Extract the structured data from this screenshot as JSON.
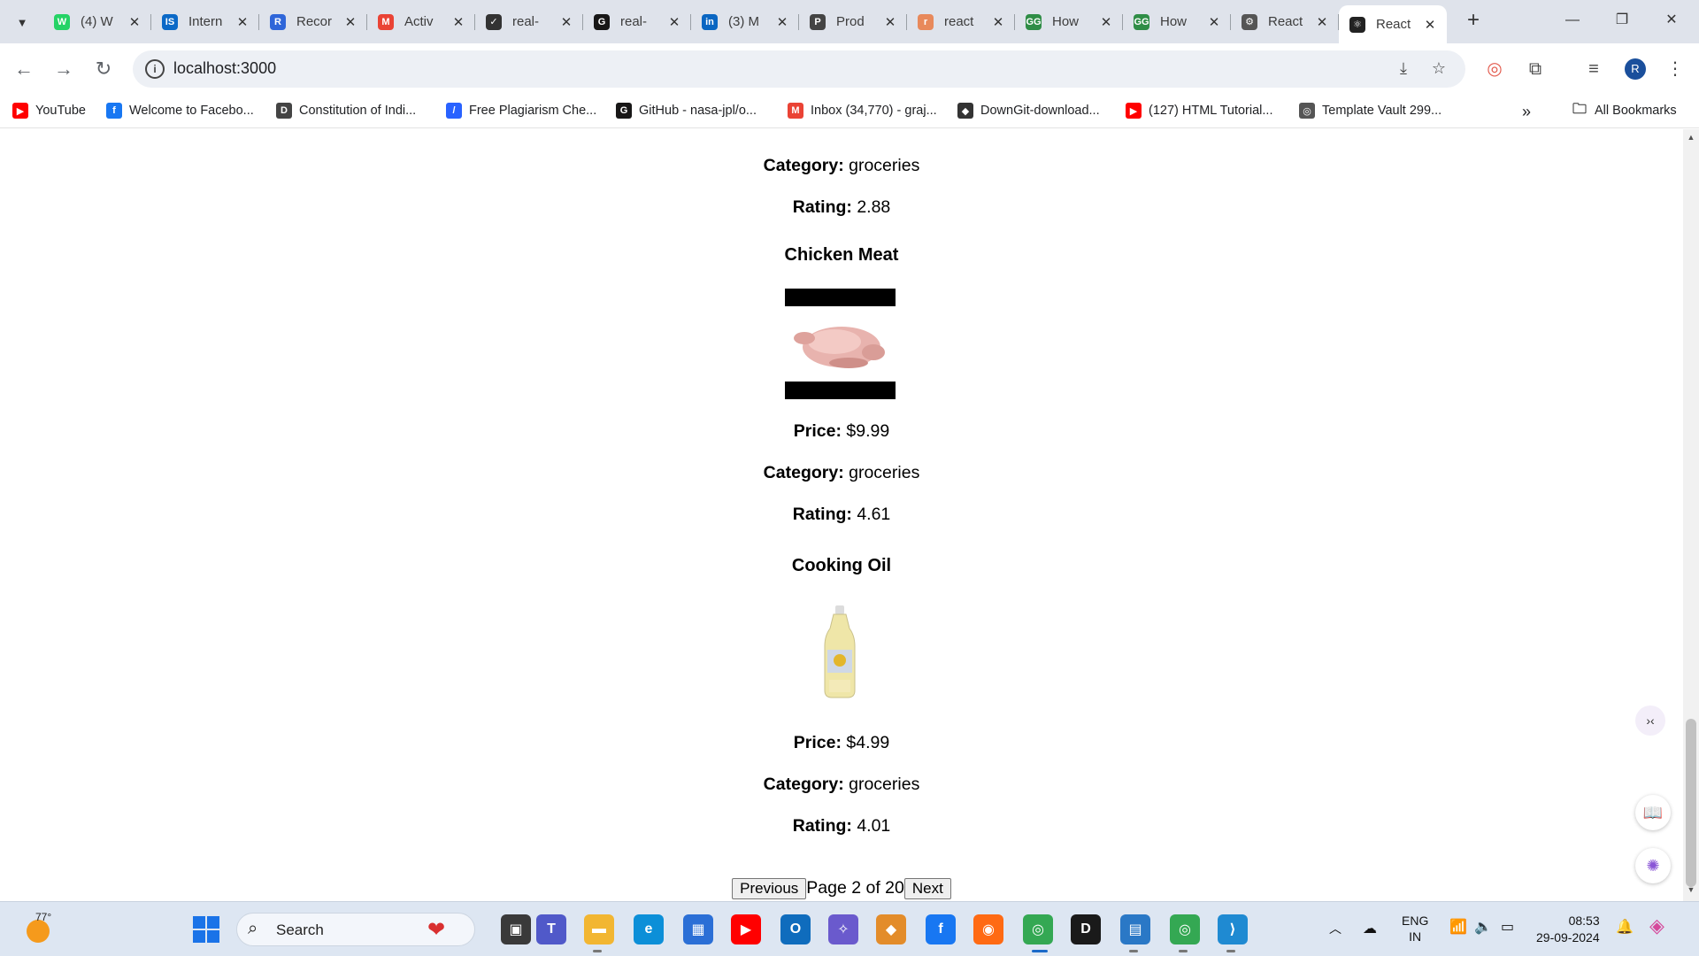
{
  "browser": {
    "tabs": [
      {
        "title": "(4) W",
        "color": "#25d366",
        "glyph": "W",
        "icon": "whatsapp-icon"
      },
      {
        "title": "Intern",
        "color": "#0b69c7",
        "glyph": "IS",
        "icon": "internshala-icon"
      },
      {
        "title": "Recor",
        "color": "#2f66d9",
        "glyph": "R",
        "icon": "record-icon"
      },
      {
        "title": "Activ",
        "color": "#ea4335",
        "glyph": "M",
        "icon": "gmail-icon"
      },
      {
        "title": "real-",
        "color": "#333333",
        "glyph": "✓",
        "icon": "app-icon"
      },
      {
        "title": "real-",
        "color": "#181717",
        "glyph": "G",
        "icon": "github-icon"
      },
      {
        "title": "(3) M",
        "color": "#0a66c2",
        "glyph": "in",
        "icon": "linkedin-icon"
      },
      {
        "title": "Prod",
        "color": "#444444",
        "glyph": "P",
        "icon": "product-icon"
      },
      {
        "title": "react",
        "color": "#e8895b",
        "glyph": "r",
        "icon": "react-docs-icon"
      },
      {
        "title": "How",
        "color": "#2f8d46",
        "glyph": "GG",
        "icon": "geeksforgeeks-icon"
      },
      {
        "title": "How",
        "color": "#2f8d46",
        "glyph": "GG",
        "icon": "geeksforgeeks-icon"
      },
      {
        "title": "React",
        "color": "#555555",
        "glyph": "⚙",
        "icon": "openai-icon"
      },
      {
        "title": "React",
        "color": "#222222",
        "glyph": "⚛",
        "icon": "react-icon",
        "active": true
      }
    ],
    "url": "localhost:3000",
    "avatar_letter": "R",
    "bookmarks": [
      {
        "label": "YouTube",
        "color": "#ff0000",
        "glyph": "▶"
      },
      {
        "label": "Welcome to Facebo...",
        "color": "#1877f2",
        "glyph": "f"
      },
      {
        "label": "Constitution of Indi...",
        "color": "#444444",
        "glyph": "D"
      },
      {
        "label": "Free Plagiarism Che...",
        "color": "#2962ff",
        "glyph": "/"
      },
      {
        "label": "GitHub - nasa-jpl/o...",
        "color": "#181717",
        "glyph": "G"
      },
      {
        "label": "Inbox (34,770) - graj...",
        "color": "#ea4335",
        "glyph": "M"
      },
      {
        "label": "DownGit-download...",
        "color": "#333333",
        "glyph": "◆"
      },
      {
        "label": "(127) HTML Tutorial...",
        "color": "#ff0000",
        "glyph": "▶"
      },
      {
        "label": "Template Vault 299...",
        "color": "#555555",
        "glyph": "◎"
      }
    ],
    "more_bookmarks": "»",
    "all_bookmarks_label": "All Bookmarks"
  },
  "page": {
    "top_category": {
      "label": "Category:",
      "value": "groceries"
    },
    "top_rating": {
      "label": "Rating:",
      "value": "2.88"
    },
    "products": [
      {
        "name": "Chicken Meat",
        "image": "chicken-image",
        "price_label": "Price:",
        "price": "$9.99",
        "category_label": "Category:",
        "category": "groceries",
        "rating_label": "Rating:",
        "rating": "4.61"
      },
      {
        "name": "Cooking Oil",
        "image": "cooking-oil-image",
        "price_label": "Price:",
        "price": "$4.99",
        "category_label": "Category:",
        "category": "groceries",
        "rating_label": "Rating:",
        "rating": "4.01"
      }
    ],
    "pagination": {
      "previous_label": "Previous",
      "status": "Page 2 of 20",
      "next_label": "Next"
    }
  },
  "taskbar": {
    "weather_temp": "77°",
    "search_placeholder": "Search",
    "lang_line1": "ENG",
    "lang_line2": "IN",
    "time": "08:53",
    "date": "29-09-2024"
  }
}
